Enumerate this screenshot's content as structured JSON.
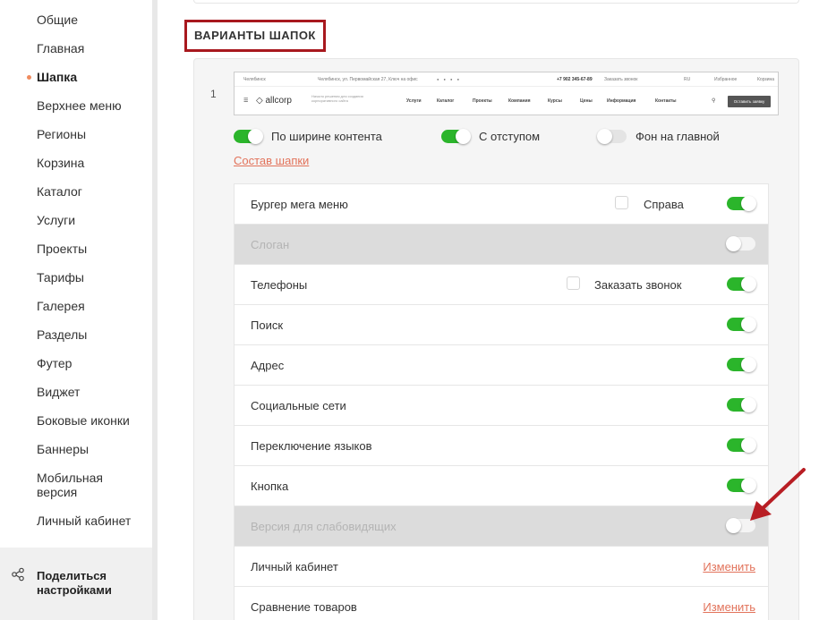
{
  "sidebar": {
    "items": [
      {
        "label": "Общие",
        "active": false
      },
      {
        "label": "Главная",
        "active": false
      },
      {
        "label": "Шапка",
        "active": true
      },
      {
        "label": "Верхнее меню",
        "active": false
      },
      {
        "label": "Регионы",
        "active": false
      },
      {
        "label": "Корзина",
        "active": false
      },
      {
        "label": "Каталог",
        "active": false
      },
      {
        "label": "Услуги",
        "active": false
      },
      {
        "label": "Проекты",
        "active": false
      },
      {
        "label": "Тарифы",
        "active": false
      },
      {
        "label": "Галерея",
        "active": false
      },
      {
        "label": "Разделы",
        "active": false
      },
      {
        "label": "Футер",
        "active": false
      },
      {
        "label": "Виджет",
        "active": false
      },
      {
        "label": "Боковые иконки",
        "active": false
      },
      {
        "label": "Баннеры",
        "active": false
      },
      {
        "label": "Мобильная версия",
        "active": false
      },
      {
        "label": "Личный кабинет",
        "active": false
      }
    ],
    "share_label": "Поделиться настройками",
    "share_icon": "share-icon",
    "active_dot_color": "#f08b5e"
  },
  "main": {
    "section_title": "ВАРИАНТЫ ШАПОК",
    "variant": {
      "number": "1",
      "preview": {
        "city": "Челябинск",
        "address": "Челябинск, ул. Первомайская 27, Ключ на офис",
        "phone": "+7 902 345-67-89",
        "callback": "Заказать звонок",
        "lang": "RU",
        "favorites": "Избранное",
        "cart": "Корзина",
        "logo": "allcorp",
        "slogan": "Начало решения для создания корпоративного сайта",
        "menu": [
          "Услуги",
          "Каталог",
          "Проекты",
          "Компания",
          "Курсы",
          "Цены",
          "Информация",
          "Контакты"
        ],
        "button": "Оставить заявку"
      },
      "options": [
        {
          "label": "По ширине контента",
          "on": true
        },
        {
          "label": "С отступом",
          "on": true
        },
        {
          "label": "Фон на главной",
          "on": false
        }
      ],
      "compose_link": "Состав шапки",
      "rows": [
        {
          "label": "Бургер мега меню",
          "disabled": false,
          "checkbox_label": "Справа",
          "toggle": true
        },
        {
          "label": "Слоган",
          "disabled": true,
          "toggle": false
        },
        {
          "label": "Телефоны",
          "disabled": false,
          "checkbox_label": "Заказать звонок",
          "toggle": true
        },
        {
          "label": "Поиск",
          "disabled": false,
          "toggle": true
        },
        {
          "label": "Адрес",
          "disabled": false,
          "toggle": true
        },
        {
          "label": "Социальные сети",
          "disabled": false,
          "toggle": true
        },
        {
          "label": "Переключение языков",
          "disabled": false,
          "toggle": true
        },
        {
          "label": "Кнопка",
          "disabled": false,
          "toggle": true
        },
        {
          "label": "Версия для слабовидящих",
          "disabled": true,
          "toggle": false
        },
        {
          "label": "Личный кабинет",
          "disabled": false,
          "link": "Изменить"
        },
        {
          "label": "Сравнение товаров",
          "disabled": false,
          "link": "Изменить"
        }
      ]
    }
  },
  "colors": {
    "toggle_on": "#2bb52b",
    "link": "#e2735b",
    "highlight_border": "#a8181e",
    "annotation_arrow": "#b81e24"
  }
}
